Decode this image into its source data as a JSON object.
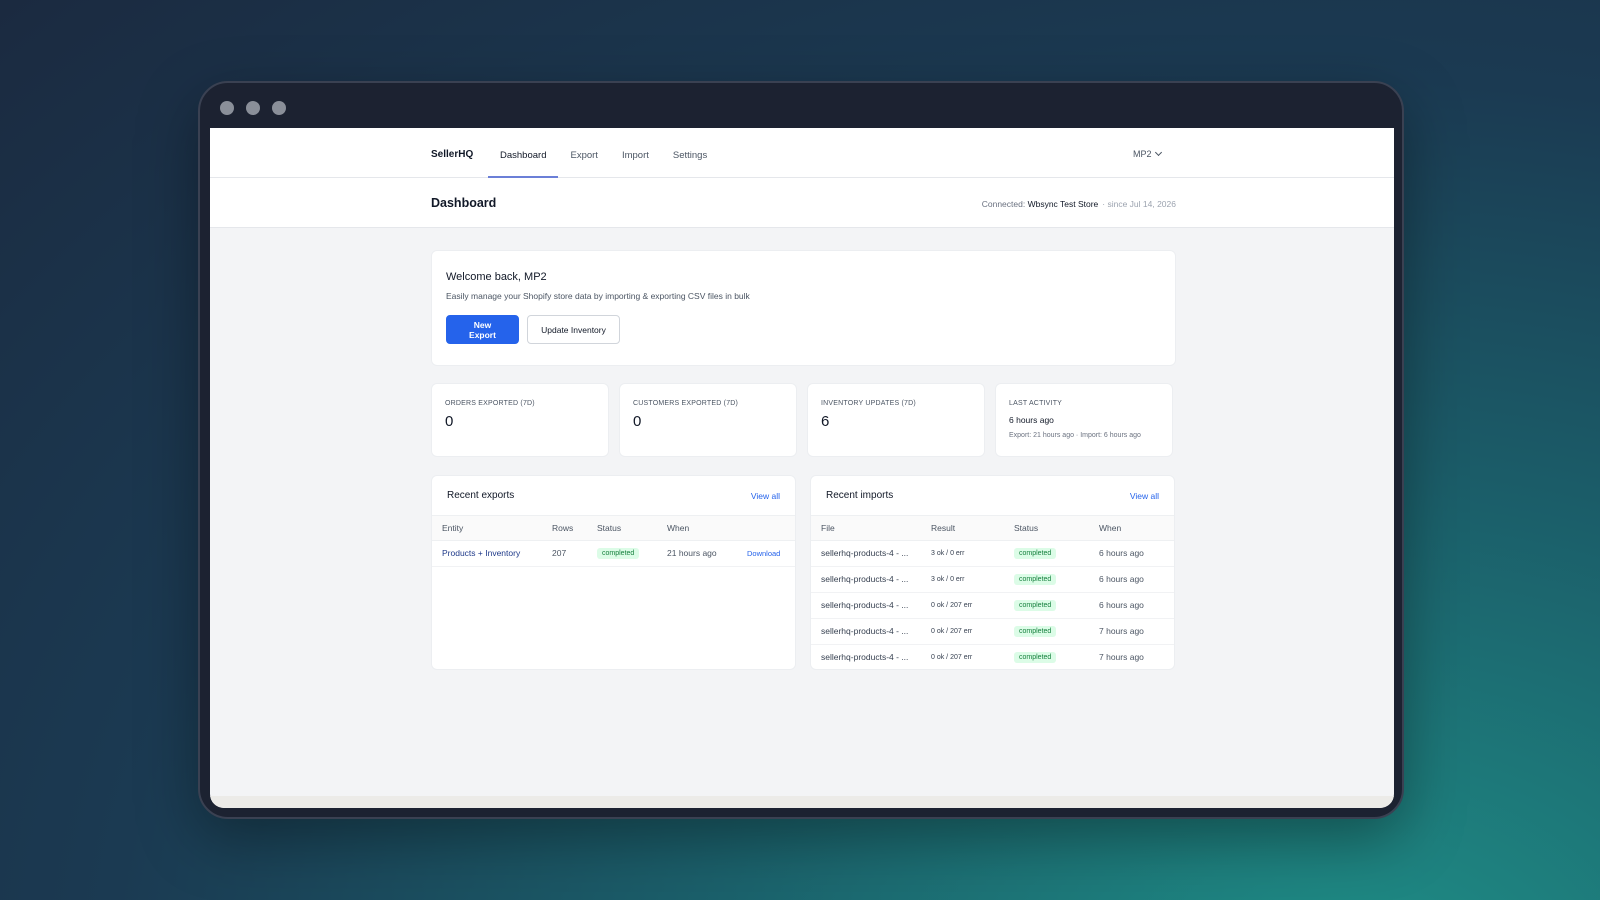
{
  "nav": {
    "brand": "SellerHQ",
    "tabs": [
      {
        "label": "Dashboard",
        "active": true
      },
      {
        "label": "Export",
        "active": false
      },
      {
        "label": "Import",
        "active": false
      },
      {
        "label": "Settings",
        "active": false
      }
    ],
    "user": "MP2"
  },
  "header": {
    "title": "Dashboard",
    "connected_prefix": "Connected: ",
    "store": "Wbsync Test Store",
    "since": "· since Jul 14, 2026"
  },
  "welcome": {
    "title": "Welcome back, MP2",
    "subtitle": "Easily manage your Shopify store data by importing & exporting CSV files in bulk",
    "primary_button": "New Export",
    "secondary_button": "Update Inventory"
  },
  "stats": [
    {
      "label": "ORDERS EXPORTED (7D)",
      "value": "0"
    },
    {
      "label": "CUSTOMERS EXPORTED (7D)",
      "value": "0"
    },
    {
      "label": "INVENTORY UPDATES (7D)",
      "value": "6"
    },
    {
      "label": "LAST ACTIVITY",
      "sub": "6 hours ago",
      "detail": "Export: 21 hours ago · Import: 6 hours ago"
    }
  ],
  "exports": {
    "title": "Recent exports",
    "view_all": "View all",
    "columns": [
      "Entity",
      "Rows",
      "Status",
      "When",
      ""
    ],
    "rows": [
      {
        "entity": "Products + Inventory",
        "rows": "207",
        "status": "completed",
        "when": "21 hours ago",
        "action": "Download"
      }
    ]
  },
  "imports": {
    "title": "Recent imports",
    "view_all": "View all",
    "columns": [
      "File",
      "Result",
      "Status",
      "When"
    ],
    "rows": [
      {
        "file": "sellerhq-products-4 - ...",
        "result": "3 ok / 0 err",
        "status": "completed",
        "when": "6 hours ago"
      },
      {
        "file": "sellerhq-products-4 - ...",
        "result": "3 ok / 0 err",
        "status": "completed",
        "when": "6 hours ago"
      },
      {
        "file": "sellerhq-products-4 - ...",
        "result": "0 ok / 207 err",
        "status": "completed",
        "when": "6 hours ago"
      },
      {
        "file": "sellerhq-products-4 - ...",
        "result": "0 ok / 207 err",
        "status": "completed",
        "when": "7 hours ago"
      },
      {
        "file": "sellerhq-products-4 - ...",
        "result": "0 ok / 207 err",
        "status": "completed",
        "when": "7 hours ago"
      }
    ]
  },
  "colors": {
    "accent": "#2563eb",
    "badge_bg": "#dcfce7",
    "badge_text": "#15803d"
  }
}
